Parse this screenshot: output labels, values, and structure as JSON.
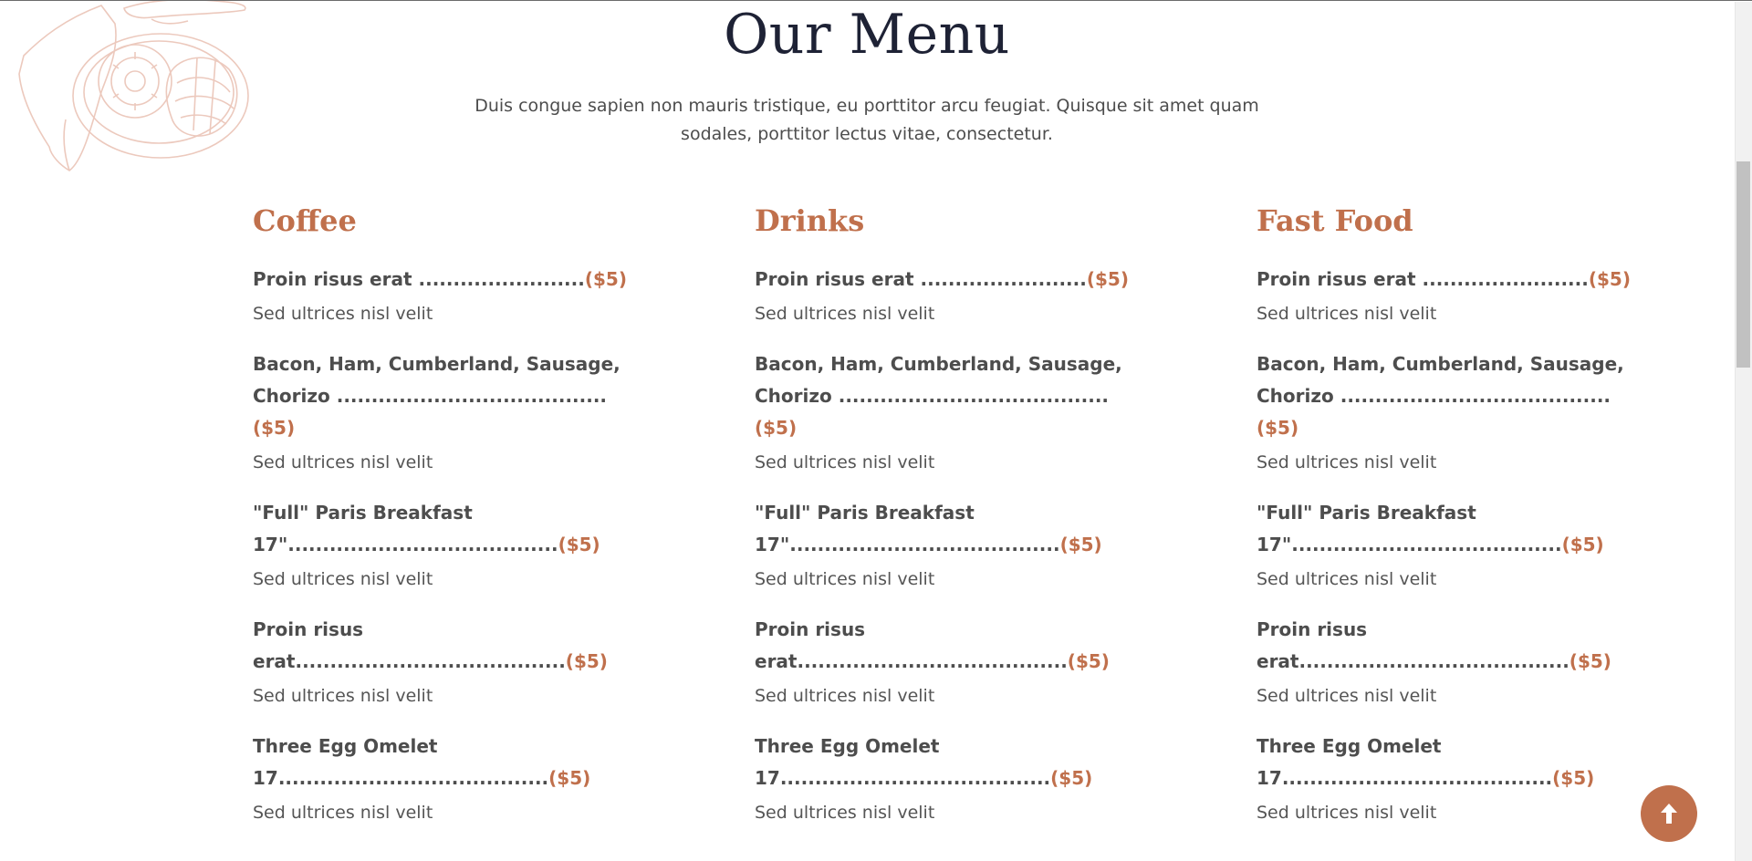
{
  "section": {
    "heading": "Our Menu",
    "intro": "Duis congue sapien non mauris tristique, eu porttitor arcu feugiat. Quisque sit amet quam sodales, porttitor lectus vitae, consectetur."
  },
  "columns": [
    {
      "title": "Coffee",
      "items": [
        {
          "name": "Proin risus erat ........................",
          "price": "($5)",
          "desc": "Sed ultrices nisl velit"
        },
        {
          "name": "Bacon, Ham, Cumberland, Sausage, Chorizo .......................................",
          "price": "($5)",
          "desc": "Sed ultrices nisl velit"
        },
        {
          "name": "\"Full\" Paris Breakfast 17\".......................................",
          "price": "($5)",
          "desc": "Sed ultrices nisl velit"
        },
        {
          "name": "Proin risus erat.......................................",
          "price": "($5)",
          "desc": "Sed ultrices nisl velit"
        },
        {
          "name": "Three Egg Omelet 17.......................................",
          "price": "($5)",
          "desc": "Sed ultrices nisl velit"
        }
      ]
    },
    {
      "title": "Drinks",
      "items": [
        {
          "name": "Proin risus erat ........................",
          "price": "($5)",
          "desc": "Sed ultrices nisl velit"
        },
        {
          "name": "Bacon, Ham, Cumberland, Sausage, Chorizo .......................................",
          "price": "($5)",
          "desc": "Sed ultrices nisl velit"
        },
        {
          "name": "\"Full\" Paris Breakfast 17\".......................................",
          "price": "($5)",
          "desc": "Sed ultrices nisl velit"
        },
        {
          "name": "Proin risus erat.......................................",
          "price": "($5)",
          "desc": "Sed ultrices nisl velit"
        },
        {
          "name": "Three Egg Omelet 17.......................................",
          "price": "($5)",
          "desc": "Sed ultrices nisl velit"
        }
      ]
    },
    {
      "title": "Fast Food",
      "items": [
        {
          "name": "Proin risus erat ........................",
          "price": "($5)",
          "desc": "Sed ultrices nisl velit"
        },
        {
          "name": "Bacon, Ham, Cumberland, Sausage, Chorizo .......................................",
          "price": "($5)",
          "desc": "Sed ultrices nisl velit"
        },
        {
          "name": "\"Full\" Paris Breakfast 17\".......................................",
          "price": "($5)",
          "desc": "Sed ultrices nisl velit"
        },
        {
          "name": "Proin risus erat.......................................",
          "price": "($5)",
          "desc": "Sed ultrices nisl velit"
        },
        {
          "name": "Three Egg Omelet 17.......................................",
          "price": "($5)",
          "desc": "Sed ultrices nisl velit"
        }
      ]
    }
  ],
  "icons": {
    "scroll_top": "arrow-up-icon",
    "decor": "food-plate-illustration"
  },
  "colors": {
    "accent": "#c0704c",
    "heading": "#1e2235",
    "text": "#4d4d4d"
  }
}
